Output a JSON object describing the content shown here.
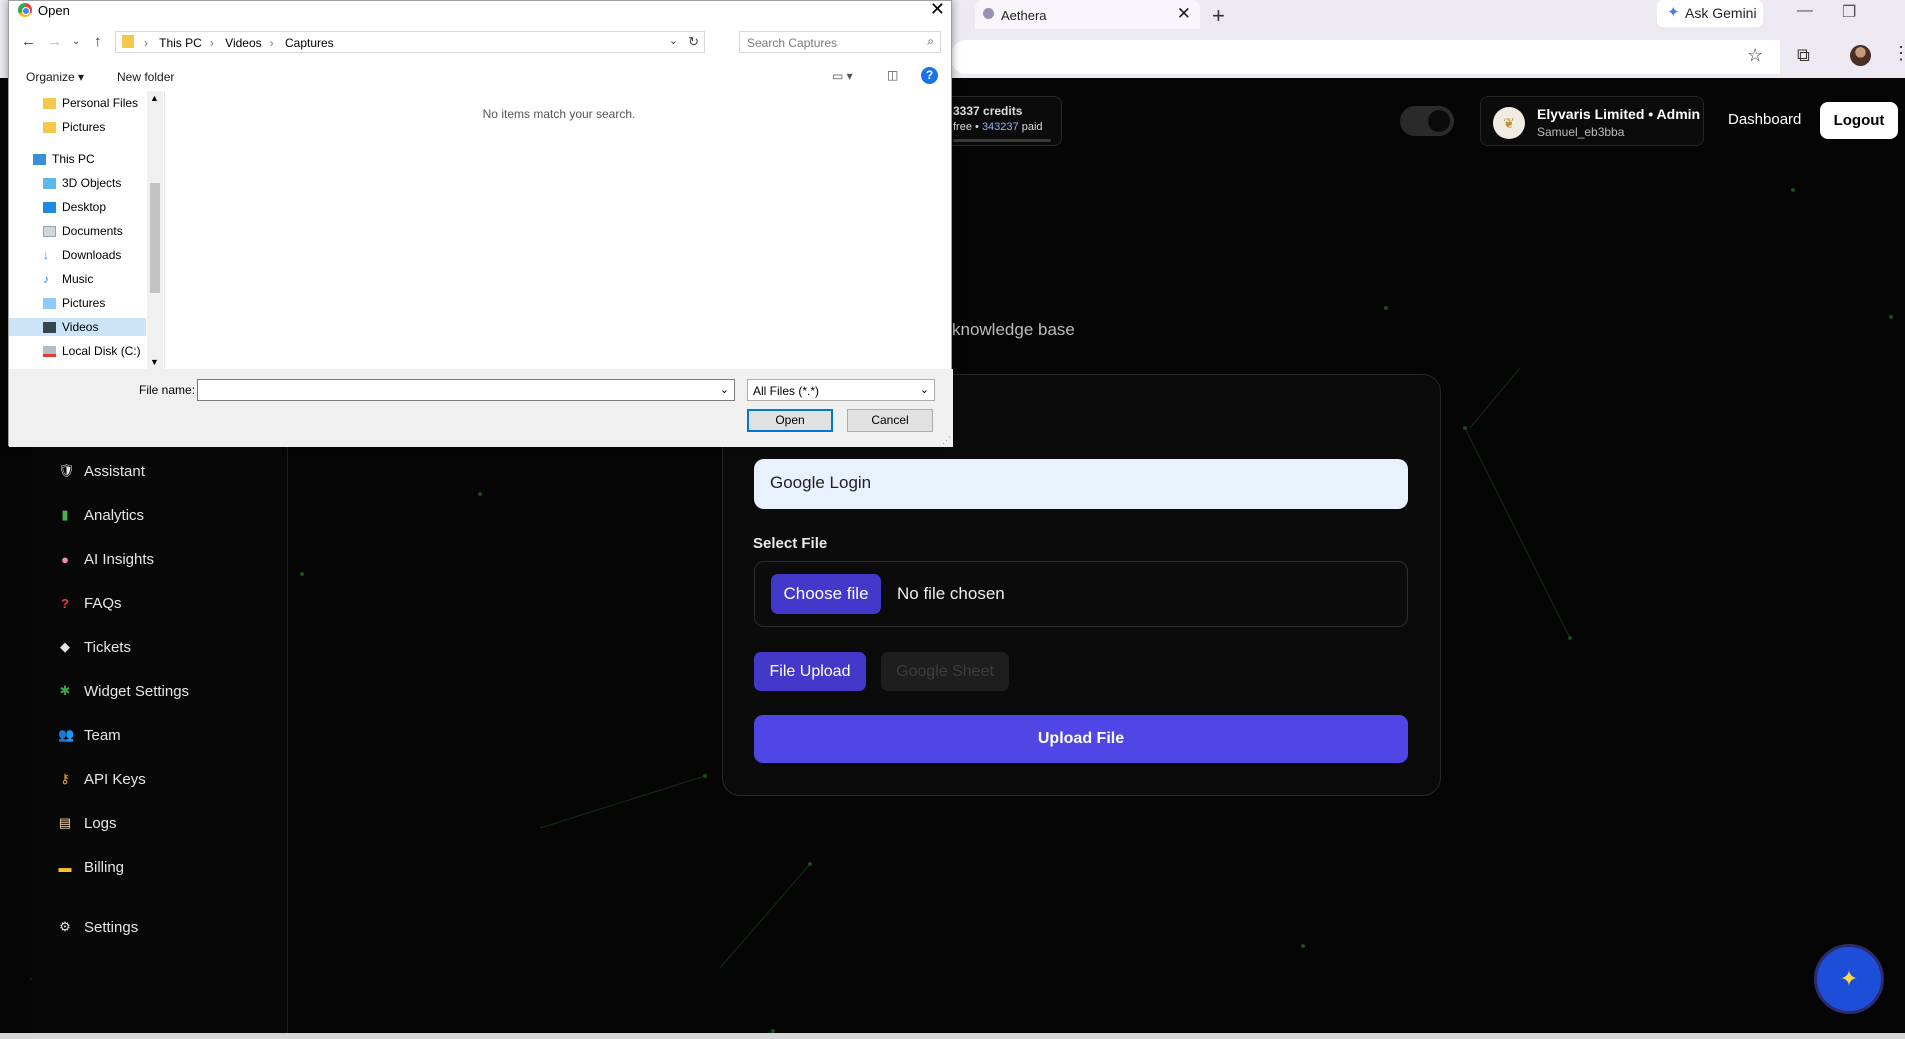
{
  "browser": {
    "tab_title": "Aethera",
    "ask_gemini": "Ask Gemini"
  },
  "header": {
    "credits_top": "3337 credits",
    "credits_free": "free",
    "credits_paid_amount": "343237",
    "credits_paid_label": "paid",
    "org_name": "Elyvaris Limited • Admin",
    "username": "Samuel_eb3bba",
    "dashboard": "Dashboard",
    "logout": "Logout"
  },
  "sidebar": {
    "items": [
      {
        "label": "Assistant",
        "icon": "assistant-icon"
      },
      {
        "label": "Analytics",
        "icon": "chart-icon"
      },
      {
        "label": "AI Insights",
        "icon": "brain-icon"
      },
      {
        "label": "FAQs",
        "icon": "question-icon"
      },
      {
        "label": "Tickets",
        "icon": "ticket-icon"
      },
      {
        "label": "Widget Settings",
        "icon": "puzzle-icon"
      },
      {
        "label": "Team",
        "icon": "team-icon"
      },
      {
        "label": "API Keys",
        "icon": "key-icon"
      },
      {
        "label": "Logs",
        "icon": "scroll-icon"
      },
      {
        "label": "Billing",
        "icon": "card-icon"
      },
      {
        "label": "Settings",
        "icon": "gear-icon"
      }
    ]
  },
  "main": {
    "subtitle": "knowledge base",
    "name_value": "Google Login",
    "select_file_label": "Select File",
    "choose_file": "Choose file",
    "no_file": "No file chosen",
    "tab_file_upload": "File Upload",
    "tab_google_sheet": "Google Sheet",
    "upload_button": "Upload File"
  },
  "dialog": {
    "title": "Open",
    "path": [
      "This PC",
      "Videos",
      "Captures"
    ],
    "search_placeholder": "Search Captures",
    "organize": "Organize",
    "new_folder": "New folder",
    "tree": [
      {
        "label": "Personal Files",
        "level": 1
      },
      {
        "label": "Pictures",
        "level": 1
      },
      {
        "label": "This PC",
        "level": 0
      },
      {
        "label": "3D Objects",
        "level": 1
      },
      {
        "label": "Desktop",
        "level": 1
      },
      {
        "label": "Documents",
        "level": 1
      },
      {
        "label": "Downloads",
        "level": 1
      },
      {
        "label": "Music",
        "level": 1
      },
      {
        "label": "Pictures",
        "level": 1
      },
      {
        "label": "Videos",
        "level": 1,
        "selected": true
      },
      {
        "label": "Local Disk (C:)",
        "level": 1
      }
    ],
    "empty_message": "No items match your search.",
    "file_name_label": "File name:",
    "file_name_value": "",
    "file_type": "All Files (*.*)",
    "open_button": "Open",
    "cancel_button": "Cancel"
  },
  "colors": {
    "accent": "#4f46e5",
    "accent_dark": "#4338ca",
    "background": "#050505",
    "dialog_selection": "#cce4f7"
  }
}
